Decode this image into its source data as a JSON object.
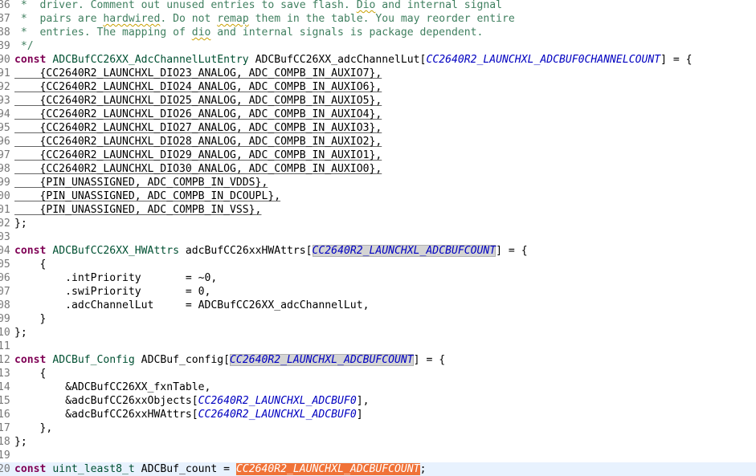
{
  "editor": {
    "lines": [
      {
        "num": "86",
        "tokens": [
          {
            "t": " *  driver. Comment out unused entries to save flash. ",
            "c": "cm"
          },
          {
            "t": "Dio",
            "c": "cm sq"
          },
          {
            "t": " and internal signal",
            "c": "cm"
          }
        ]
      },
      {
        "num": "87",
        "tokens": [
          {
            "t": " *  pairs are ",
            "c": "cm"
          },
          {
            "t": "hardwired",
            "c": "cm sq"
          },
          {
            "t": ". Do not ",
            "c": "cm"
          },
          {
            "t": "remap",
            "c": "cm sq"
          },
          {
            "t": " them in the table. You may reorder entire",
            "c": "cm"
          }
        ]
      },
      {
        "num": "88",
        "tokens": [
          {
            "t": " *  entries. The mapping of ",
            "c": "cm"
          },
          {
            "t": "dio",
            "c": "cm sq"
          },
          {
            "t": " and internal signals is package dependent.",
            "c": "cm"
          }
        ]
      },
      {
        "num": "89",
        "tokens": [
          {
            "t": " */",
            "c": "cm"
          }
        ]
      },
      {
        "num": "90",
        "tokens": [
          {
            "t": "const",
            "c": "kw"
          },
          {
            "t": " "
          },
          {
            "t": "ADCBufCC26XX_AdcChannelLutEntry",
            "c": "ty"
          },
          {
            "t": " ADCBufCC26XX_adcChannelLut["
          },
          {
            "t": "CC2640R2_LAUNCHXL_ADCBUF0CHANNELCOUNT",
            "c": "mac"
          },
          {
            "t": "] = {"
          }
        ]
      },
      {
        "num": "91",
        "tokens": [
          {
            "t": "    {CC2640R2_LAUNCHXL_DIO23_ANALOG, ADC_COMPB_IN_AUXIO7},",
            "c": "ul"
          }
        ]
      },
      {
        "num": "92",
        "tokens": [
          {
            "t": "    {CC2640R2_LAUNCHXL_DIO24_ANALOG, ADC_COMPB_IN_AUXIO6},",
            "c": "ul"
          }
        ]
      },
      {
        "num": "93",
        "tokens": [
          {
            "t": "    {CC2640R2_LAUNCHXL_DIO25_ANALOG, ADC_COMPB_IN_AUXIO5},",
            "c": "ul"
          }
        ]
      },
      {
        "num": "94",
        "tokens": [
          {
            "t": "    {CC2640R2_LAUNCHXL_DIO26_ANALOG, ADC_COMPB_IN_AUXIO4},",
            "c": "ul"
          }
        ]
      },
      {
        "num": "95",
        "tokens": [
          {
            "t": "    {CC2640R2_LAUNCHXL_DIO27_ANALOG, ADC_COMPB_IN_AUXIO3},",
            "c": "ul"
          }
        ]
      },
      {
        "num": "96",
        "tokens": [
          {
            "t": "    {CC2640R2_LAUNCHXL_DIO28_ANALOG, ADC_COMPB_IN_AUXIO2},",
            "c": "ul"
          }
        ]
      },
      {
        "num": "97",
        "tokens": [
          {
            "t": "    {CC2640R2_LAUNCHXL_DIO29_ANALOG, ADC_COMPB_IN_AUXIO1},",
            "c": "ul"
          }
        ]
      },
      {
        "num": "98",
        "tokens": [
          {
            "t": "    {CC2640R2_LAUNCHXL_DIO30_ANALOG, ADC_COMPB_IN_AUXIO0},",
            "c": "ul"
          }
        ]
      },
      {
        "num": "99",
        "tokens": [
          {
            "t": "    {PIN_UNASSIGNED, ADC_COMPB_IN_VDDS},",
            "c": "ul"
          }
        ]
      },
      {
        "num": "00",
        "tokens": [
          {
            "t": "    {PIN_UNASSIGNED, ADC_COMPB_IN_DCOUPL},",
            "c": "ul"
          }
        ]
      },
      {
        "num": "01",
        "tokens": [
          {
            "t": "    {PIN_UNASSIGNED, ADC_COMPB_IN_VSS},",
            "c": "ul"
          }
        ]
      },
      {
        "num": "02",
        "tokens": [
          {
            "t": "};"
          }
        ]
      },
      {
        "num": "03",
        "tokens": []
      },
      {
        "num": "04",
        "tokens": [
          {
            "t": "const",
            "c": "kw"
          },
          {
            "t": " "
          },
          {
            "t": "ADCBufCC26XX_HWAttrs",
            "c": "ty"
          },
          {
            "t": " adcBufCC26xxHWAttrs["
          },
          {
            "t": "CC2640R2_LAUNCHXL_ADCBUFCOUNT",
            "c": "mac hl"
          },
          {
            "t": "] = {"
          }
        ]
      },
      {
        "num": "05",
        "tokens": [
          {
            "t": "    {"
          }
        ]
      },
      {
        "num": "06",
        "tokens": [
          {
            "t": "        .intPriority       = ~0,"
          }
        ]
      },
      {
        "num": "07",
        "tokens": [
          {
            "t": "        .swiPriority       = 0,"
          }
        ]
      },
      {
        "num": "08",
        "tokens": [
          {
            "t": "        .adcChannelLut     = ADCBufCC26XX_adcChannelLut,"
          }
        ]
      },
      {
        "num": "09",
        "tokens": [
          {
            "t": "    }"
          }
        ]
      },
      {
        "num": "10",
        "tokens": [
          {
            "t": "};"
          }
        ]
      },
      {
        "num": "11",
        "tokens": []
      },
      {
        "num": "12",
        "tokens": [
          {
            "t": "const",
            "c": "kw"
          },
          {
            "t": " "
          },
          {
            "t": "ADCBuf_Config",
            "c": "ty"
          },
          {
            "t": " ADCBuf_config["
          },
          {
            "t": "CC2640R2_LAUNCHXL_ADCBUFCOUNT",
            "c": "mac hl"
          },
          {
            "t": "] = {"
          }
        ]
      },
      {
        "num": "13",
        "tokens": [
          {
            "t": "    {"
          }
        ]
      },
      {
        "num": "14",
        "tokens": [
          {
            "t": "        &ADCBufCC26XX_fxnTable,"
          }
        ]
      },
      {
        "num": "15",
        "tokens": [
          {
            "t": "        &adcBufCC26xxObjects["
          },
          {
            "t": "CC2640R2_LAUNCHXL_ADCBUF0",
            "c": "mac"
          },
          {
            "t": "],"
          }
        ]
      },
      {
        "num": "16",
        "tokens": [
          {
            "t": "        &adcBufCC26xxHWAttrs["
          },
          {
            "t": "CC2640R2_LAUNCHXL_ADCBUF0",
            "c": "mac"
          },
          {
            "t": "]"
          }
        ]
      },
      {
        "num": "17",
        "tokens": [
          {
            "t": "    },"
          }
        ]
      },
      {
        "num": "18",
        "tokens": [
          {
            "t": "};"
          }
        ]
      },
      {
        "num": "19",
        "tokens": []
      },
      {
        "num": "20",
        "current": true,
        "tokens": [
          {
            "t": "const",
            "c": "kw"
          },
          {
            "t": " "
          },
          {
            "t": "uint_least8_t",
            "c": "ty"
          },
          {
            "t": " ADCBuf_count = "
          },
          {
            "t": "CC2640R2_LAUNCHXL_ADCBUFCOUNT",
            "c": "hlo"
          },
          {
            "t": ";"
          }
        ]
      }
    ]
  }
}
